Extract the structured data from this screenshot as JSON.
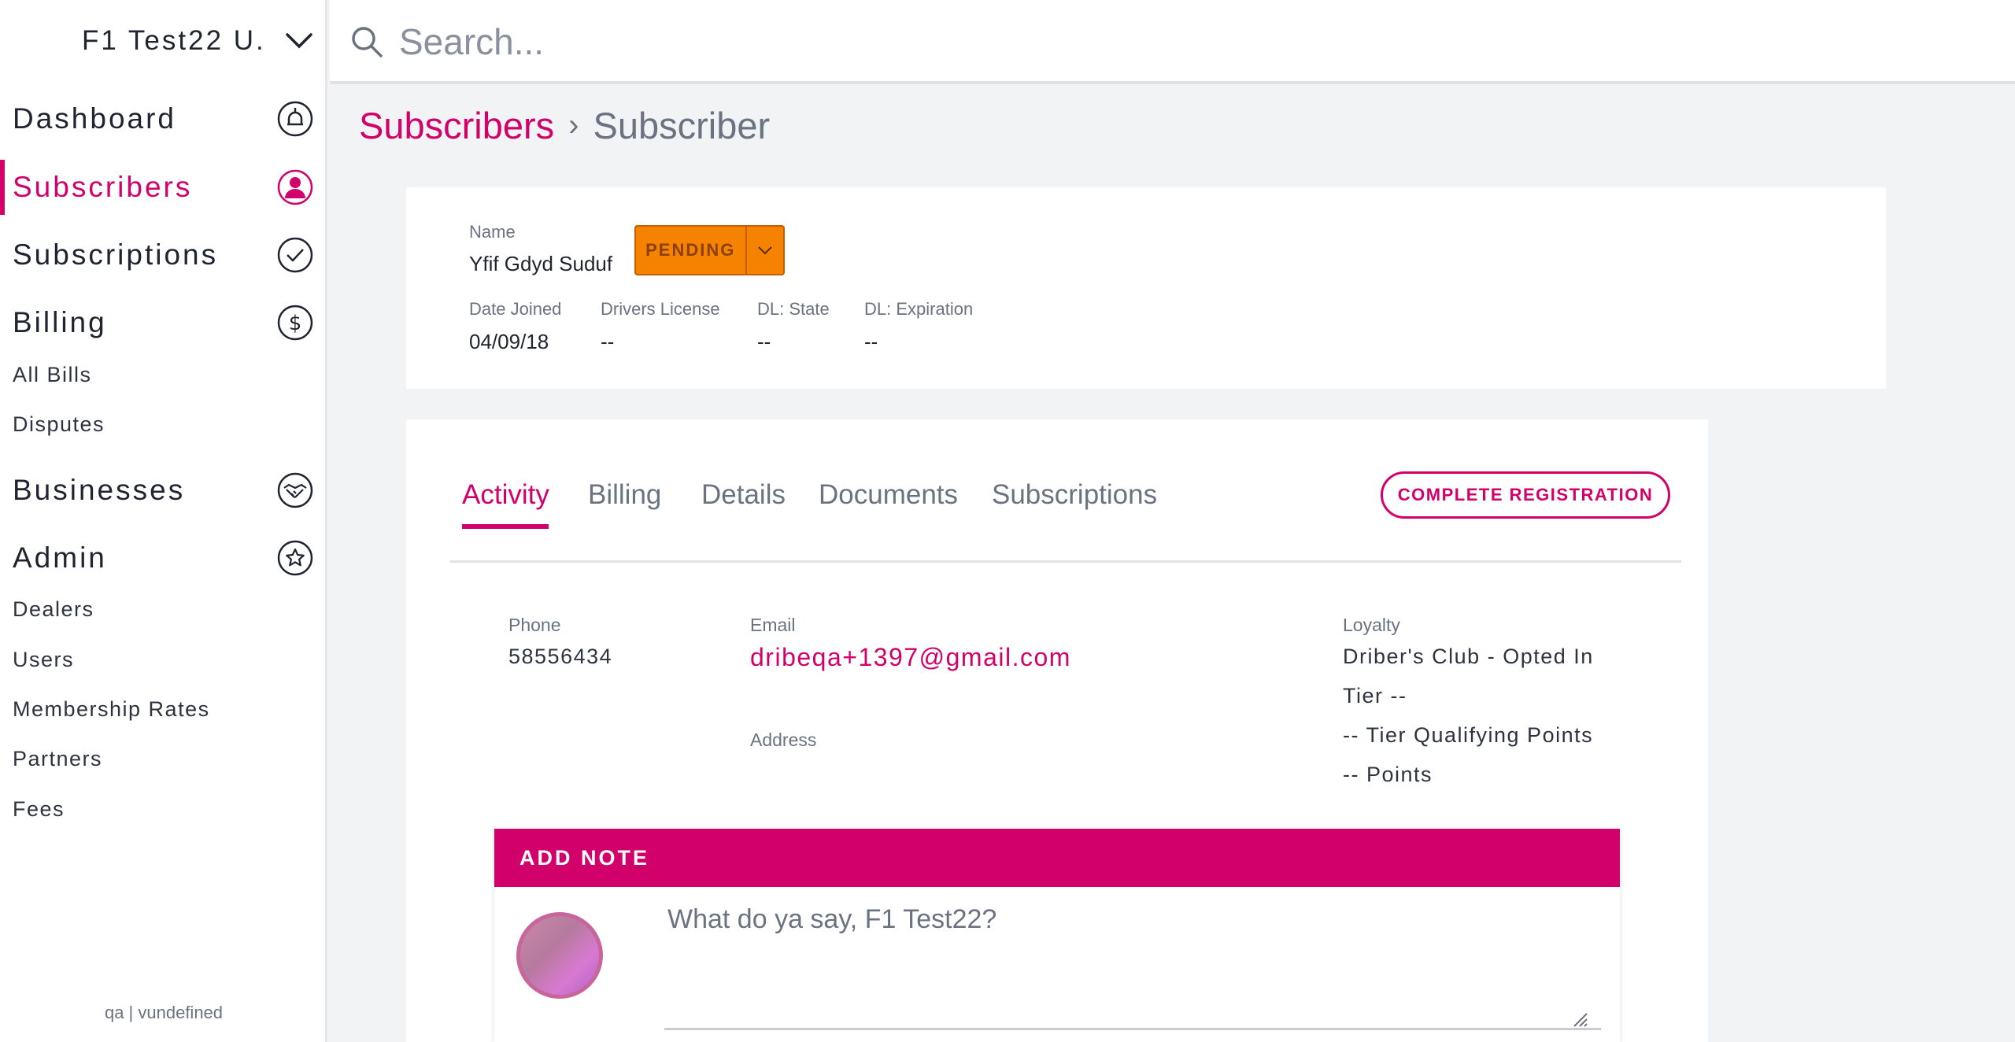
{
  "sidebar": {
    "user_name": "F1 Test22 U.",
    "nav": {
      "dashboard": "Dashboard",
      "subscribers": "Subscribers",
      "subscriptions": "Subscriptions",
      "billing": "Billing",
      "businesses": "Businesses",
      "admin": "Admin"
    },
    "billing_items": [
      "All Bills",
      "Disputes"
    ],
    "admin_items": [
      "Dealers",
      "Users",
      "Membership Rates",
      "Partners",
      "Fees"
    ],
    "footer": "qa | vundefined",
    "active_item": "Subscribers"
  },
  "search": {
    "placeholder": "Search..."
  },
  "breadcrumb": {
    "parent": "Subscribers",
    "separator": "›",
    "current": "Subscriber"
  },
  "subscriber": {
    "name_label": "Name",
    "name": "Yfif Gdyd Suduf",
    "status": "PENDING",
    "date_joined_label": "Date Joined",
    "date_joined": "04/09/18",
    "drivers_license_label": "Drivers License",
    "drivers_license": "--",
    "dl_state_label": "DL: State",
    "dl_state": "--",
    "dl_expiration_label": "DL: Expiration",
    "dl_expiration": "--"
  },
  "tabs": [
    "Activity",
    "Billing",
    "Details",
    "Documents",
    "Subscriptions"
  ],
  "active_tab": "Activity",
  "complete_registration_label": "COMPLETE REGISTRATION",
  "contact": {
    "phone_label": "Phone",
    "phone": "58556434",
    "email_label": "Email",
    "email": "dribeqa+1397@gmail.com",
    "address_label": "Address",
    "loyalty_label": "Loyalty",
    "loyalty_lines": [
      "Driber's Club - Opted In",
      "Tier --",
      "-- Tier Qualifying Points",
      "-- Points"
    ]
  },
  "note": {
    "header": "ADD NOTE",
    "placeholder": "What do ya say, F1 Test22?"
  },
  "colors": {
    "accent": "#d1006a",
    "status_pending": "#f58200"
  }
}
